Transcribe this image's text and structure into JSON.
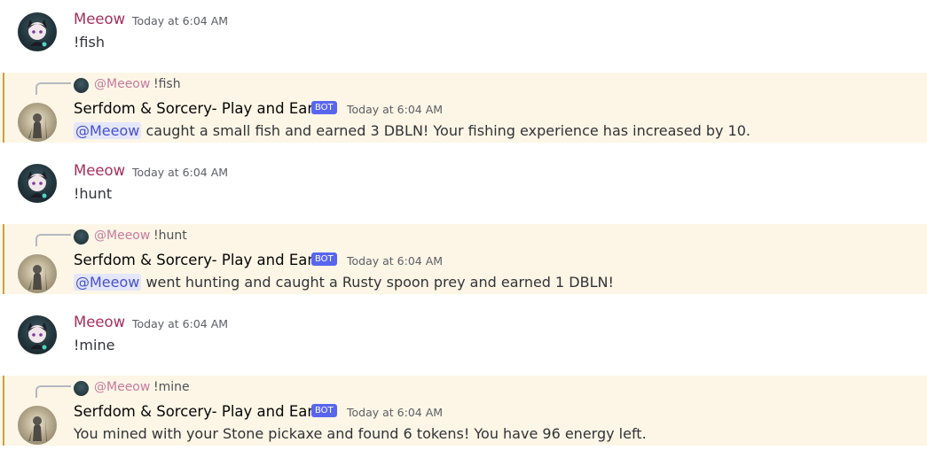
{
  "messages": [
    {
      "type": "user",
      "author": "Meeow",
      "time": "Today at 6:04 AM",
      "text": "!fish"
    },
    {
      "type": "bot",
      "reply_user": "@Meeow",
      "reply_text": "!fish",
      "author": "Serfdom & Sorcery- Play and Earn",
      "badge": "BOT",
      "time": "Today at 6:04 AM",
      "mention": "@Meeow",
      "text": "caught a small fish and earned 3 DBLN! Your fishing experience has increased by 10."
    },
    {
      "type": "user",
      "author": "Meeow",
      "time": "Today at 6:04 AM",
      "text": "!hunt"
    },
    {
      "type": "bot",
      "reply_user": "@Meeow",
      "reply_text": "!hunt",
      "author": "Serfdom & Sorcery- Play and Earn",
      "badge": "BOT",
      "time": "Today at 6:04 AM",
      "mention": "@Meeow",
      "text": "went hunting and caught a Rusty spoon prey and earned 1 DBLN!"
    },
    {
      "type": "user",
      "author": "Meeow",
      "time": "Today at 6:04 AM",
      "text": "!mine"
    },
    {
      "type": "bot",
      "reply_user": "@Meeow",
      "reply_text": "!mine",
      "author": "Serfdom & Sorcery- Play and Earn",
      "badge": "BOT",
      "time": "Today at 6:04 AM",
      "text": "You mined with your Stone pickaxe and found 6 tokens! You have 96 energy left."
    }
  ],
  "colors": {
    "user_name": "#a3305e",
    "highlight_bg": "#fdf6e6",
    "bot_badge": "#5865f2",
    "mention_bg": "#e4e6fb"
  },
  "icons": {
    "user_avatar": "cat-avatar-icon",
    "bot_avatar": "knight-avatar-icon"
  }
}
